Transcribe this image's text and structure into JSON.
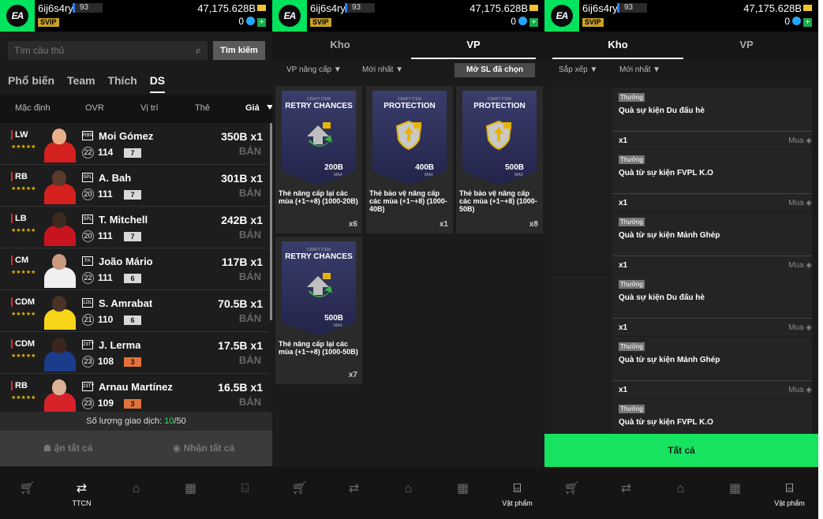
{
  "header": {
    "username": "6ij6s4ry",
    "level": "93",
    "vip": "SVIP",
    "coins": "47,175.628B",
    "bp": "0",
    "logo": "EA"
  },
  "p1": {
    "search_placeholder": "Tìm cầu thủ",
    "search_button": "Tìm kiếm",
    "tabs": [
      "Phổ biến",
      "Team",
      "Thích",
      "DS"
    ],
    "sort": [
      "Mặc định",
      "OVR",
      "Vị trí",
      "Thẻ",
      "Giá"
    ],
    "players": [
      {
        "pos": "LW",
        "stars": "★★★★★",
        "club": "RBN",
        "name": "Moi Gómez",
        "rank": "22",
        "ovr": "114",
        "upg": "7",
        "price": "350B x1",
        "sell": "BÁN"
      },
      {
        "pos": "RB",
        "stars": "★★★★★",
        "club": "SPL",
        "name": "A. Bah",
        "rank": "20",
        "ovr": "111",
        "upg": "7",
        "price": "301B x1",
        "sell": "BÁN"
      },
      {
        "pos": "LB",
        "stars": "★★★★★",
        "club": "SPL",
        "name": "T. Mitchell",
        "rank": "20",
        "ovr": "111",
        "upg": "7",
        "price": "242B x1",
        "sell": "BÁN"
      },
      {
        "pos": "CM",
        "stars": "★★★★★",
        "club": "FA",
        "name": "João Mário",
        "rank": "22",
        "ovr": "111",
        "upg": "6",
        "price": "117B x1",
        "sell": "BÁN"
      },
      {
        "pos": "CDM",
        "stars": "★★★★★",
        "club": "LOL",
        "name": "S. Amrabat",
        "rank": "21",
        "ovr": "110",
        "upg": "6",
        "price": "70.5B x1",
        "sell": "BÁN"
      },
      {
        "pos": "CDM",
        "stars": "★★★★★",
        "club": "23TY",
        "name": "J. Lerma",
        "rank": "23",
        "ovr": "108",
        "upg": "3",
        "price": "17.5B x1",
        "sell": "BÁN"
      },
      {
        "pos": "RB",
        "stars": "★★★★★",
        "club": "23TY",
        "name": "Arnau Martínez",
        "rank": "23",
        "ovr": "109",
        "upg": "3",
        "price": "16.5B x1",
        "sell": "BÁN"
      }
    ],
    "trade_label": "Số lượng giao dịch: ",
    "trade_used": "10",
    "trade_total": "/50",
    "hide_all": "ận tất cả",
    "receive_all": "Nhận tất cả",
    "nav_label": "TTCN"
  },
  "p2": {
    "tabs": [
      "Kho",
      "VP"
    ],
    "filter1": "VP nâng cấp ▼",
    "filter2": "Mới nhất ▼",
    "open_btn": "Mở SL đã chọn",
    "cards": [
      {
        "sub": "CRAFT ITEM",
        "title": "RETRY CHANCES",
        "value": "200B",
        "max": "MAX",
        "name": "Thẻ nâng cấp lại các mùa (+1~+8) (1000-20B)",
        "qty": "x6"
      },
      {
        "sub": "CRAFT ITEM",
        "title": "PROTECTION",
        "value": "400B",
        "max": "MAX",
        "name": "Thẻ bảo vệ nâng cấp các mùa (+1~+8) (1000-40B)",
        "qty": "x1"
      },
      {
        "sub": "CRAFT ITEM",
        "title": "PROTECTION",
        "value": "500B",
        "max": "MAX",
        "name": "Thẻ bảo vệ nâng cấp các mùa (+1~+8) (1000-50B)",
        "qty": "x8"
      },
      {
        "sub": "CRAFT ITEM",
        "title": "RETRY CHANCES",
        "value": "500B",
        "max": "MAX",
        "name": "Thẻ nâng cấp lại các mùa (+1~+8) (1000-50B)",
        "qty": "x7"
      }
    ],
    "nav_label": "Vật phẩm"
  },
  "p3": {
    "tabs": [
      "Kho",
      "VP"
    ],
    "filter1": "Sắp xếp ▼",
    "filter2": "Mới nhất ▼",
    "rewards": [
      {
        "tag": "Thưởng",
        "title": "Quà sự kiện Du đấu hè",
        "qty": "x1",
        "buy": "Mua"
      },
      {
        "tag": "Thưởng",
        "title": "Quà từ sự kiện FVPL K.O",
        "qty": "x1",
        "buy": "Mua"
      },
      {
        "tag": "Thưởng",
        "title": "Quà từ sự kiện Mảnh Ghép",
        "qty": "x1",
        "buy": "Mua"
      },
      {
        "tag": "Thưởng",
        "title": "Quà sự kiện Du đấu hè",
        "qty": "x1",
        "buy": "Mua"
      },
      {
        "tag": "Thưởng",
        "title": "Quà từ sự kiện Mảnh Ghép",
        "qty": "x1",
        "buy": "Mua"
      },
      {
        "tag": "Thưởng",
        "title": "Quà từ sự kiện FVPL K.O",
        "qty": "",
        "buy": ""
      }
    ],
    "all_btn": "Tất cả",
    "nav_label": "Vật phẩm"
  },
  "colors": {
    "accent": "#16e461",
    "brand": "#00e35c",
    "gold": "#e6b400",
    "sell": "#666666"
  },
  "icons": [
    "search-icon",
    "cart-icon",
    "transfer-icon",
    "home-icon",
    "squad-icon",
    "items-icon",
    "diamond-icon",
    "coin-icon",
    "bp-icon"
  ]
}
